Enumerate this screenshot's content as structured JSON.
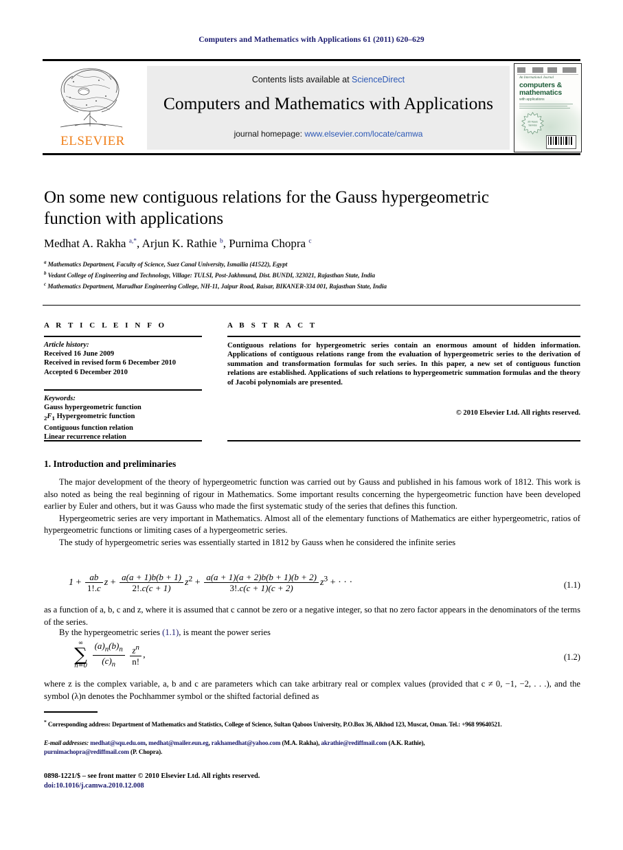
{
  "running_head": "Computers and Mathematics with Applications 61 (2011) 620–629",
  "banner": {
    "publisher_name": "ELSEVIER",
    "contents_prefix": "Contents lists available at ",
    "contents_link": "ScienceDirect",
    "journal_title": "Computers and Mathematics with Applications",
    "homepage_prefix": "journal homepage: ",
    "homepage_url": "www.elsevier.com/locate/camwa",
    "cover": {
      "kicker": "An International Journal",
      "line1": "computers &",
      "line2": "mathematics",
      "line3": "with applications"
    }
  },
  "article": {
    "title": "On some new contiguous relations for the Gauss hypergeometric function with applications",
    "authors_html": "Medhat A. Rakha <sup class=\"star\">a,*</sup>, Arjun K. Rathie <sup>b</sup>, Purnima Chopra <sup>c</sup>",
    "affiliations": [
      "Mathematics Department, Faculty of Science, Suez Canal University, Ismailia (41522), Egypt",
      "Vedant College of Engineering and Technology, Village: TULSI, Post-Jakhmund, Dist. BUNDI, 323021, Rajasthan State, India",
      "Mathematics Department, Marudhar Engineering College, NH-11, Jaipur Road, Raisar, BIKANER-334 001, Rajasthan State, India"
    ],
    "affiliation_marks": [
      "a",
      "b",
      "c"
    ]
  },
  "info": {
    "heading": "A R T I C L E   I N F O",
    "history_label": "Article history:",
    "history": [
      "Received 16 June 2009",
      "Received in revised form 6 December 2010",
      "Accepted 6 December 2010"
    ],
    "keywords_label": "Keywords:",
    "keywords_html": "Gauss hypergeometric function<br><sub>2</sub><i>F</i><sub>1</sub> Hypergeometric function<br>Contiguous function relation<br>Linear recurrence relation"
  },
  "abstract": {
    "heading": "A B S T R A C T",
    "text": "Contiguous relations for hypergeometric series contain an enormous amount of hidden information. Applications of contiguous relations range from the evaluation of hypergeometric series to the derivation of summation and transformation formulas for such series. In this paper, a new set of contiguous function relations are established. Applications of such relations to hypergeometric summation formulas and the theory of Jacobi polynomials are presented.",
    "copyright": "© 2010 Elsevier Ltd. All rights reserved."
  },
  "body": {
    "section_number": "1.",
    "section_title": "Introduction and preliminaries",
    "paragraph_1": "The major development of the theory of hypergeometric function was carried out by Gauss and published in his famous work of 1812. This work is also noted as being the real beginning of rigour in Mathematics. Some important results concerning the hypergeometric function have been developed earlier by Euler and others, but it was Gauss who made the first systematic study of the series that defines this function.",
    "paragraph_2": "Hypergeometric series are very important in Mathematics. Almost all of the elementary functions of Mathematics are either hypergeometric, ratios of hypergeometric functions or limiting cases of a hypergeometric series.",
    "paragraph_3": "The study of hypergeometric series was essentially started in 1812 by Gauss when he considered the infinite series",
    "paragraph_4": "as a function of a, b, c and z, where it is assumed that c cannot be zero or a negative integer, so that no zero factor appears in the denominators of the terms of the series.",
    "paragraph_5_pre": "By the hypergeometric series ",
    "paragraph_5_ref": "(1.1)",
    "paragraph_5_post": ", is meant the power series",
    "paragraph_6": "where z is the complex variable, a, b and c are parameters which can take arbitrary real or complex values (provided that c ≠ 0, −1, −2, . . .), and the symbol (λ)n denotes the Pochhammer symbol or the shifted factorial defined as",
    "equation_1_number": "(1.1)",
    "equation_2_number": "(1.2)"
  },
  "footnotes": {
    "corresponding_mark": "*",
    "corresponding": "Corresponding address: Department of Mathematics and Statistics, College of Science, Sultan Qaboos University, P.O.Box 36, Alkhod 123, Muscat, Oman. Tel.: +968 99640521.",
    "email_label": "E-mail addresses:",
    "emails": [
      {
        "address": "medhat@squ.edu.om",
        "owner": ""
      },
      {
        "address": "medhat@mailer.eun.eg",
        "owner": ""
      },
      {
        "address": "rakhamedhat@yahoo.com",
        "owner": "(M.A. Rakha)"
      },
      {
        "address": "akrathie@rediffmail.com",
        "owner": "(A.K. Rathie)"
      },
      {
        "address": "purnimachopra@rediffmail.com",
        "owner": "(P. Chopra)"
      }
    ]
  },
  "imprint": {
    "issn_line": "0898-1221/$ – see front matter © 2010 Elsevier Ltd. All rights reserved.",
    "doi": "doi:10.1016/j.camwa.2010.12.008"
  },
  "colors": {
    "link": "#1a1a6e",
    "banner_link": "#2b57b5",
    "elsevier_orange": "#F07F19"
  }
}
